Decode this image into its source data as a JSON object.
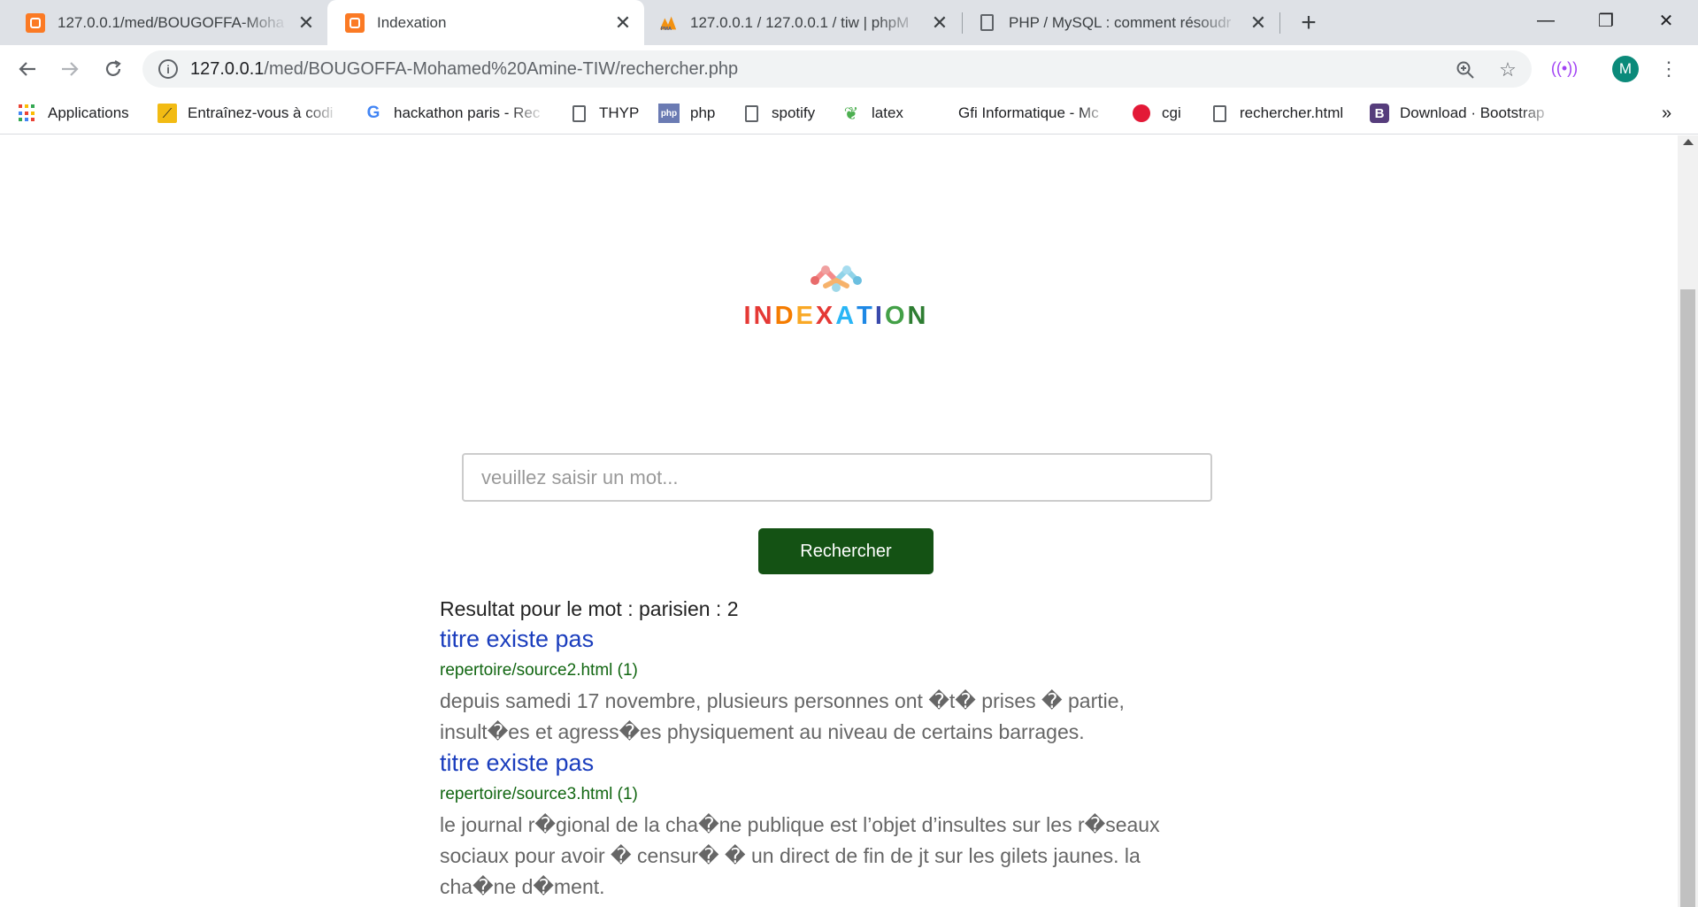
{
  "tabs": [
    {
      "title": "127.0.0.1/med/BOUGOFFA-Moha",
      "active": false
    },
    {
      "title": "Indexation",
      "active": true
    },
    {
      "title": "127.0.0.1 / 127.0.0.1 / tiw | phpM",
      "active": false
    },
    {
      "title": "PHP / MySQL : comment résoudr",
      "active": false
    }
  ],
  "window_controls": {
    "minimize": "—",
    "restore": "❐",
    "close": "✕"
  },
  "toolbar": {
    "url_host": "127.0.0.1",
    "url_path": "/med/BOUGOFFA-Mohamed%20Amine-TIW/rechercher.php",
    "avatar_letter": "M"
  },
  "bookmarks": [
    {
      "label": "Applications",
      "icon": "apps-grid-icon"
    },
    {
      "label": "Entraînez-vous à codi",
      "icon": "codingame-icon"
    },
    {
      "label": "hackathon paris - Rec",
      "icon": "google-icon"
    },
    {
      "label": "THYP",
      "icon": "page-icon"
    },
    {
      "label": "php",
      "icon": "php-icon"
    },
    {
      "label": "spotify",
      "icon": "page-icon"
    },
    {
      "label": "latex",
      "icon": "overleaf-icon"
    },
    {
      "label": "Gfi Informatique - Mc",
      "icon": "none"
    },
    {
      "label": "cgi",
      "icon": "cgi-icon"
    },
    {
      "label": "rechercher.html",
      "icon": "page-icon"
    },
    {
      "label": "Download · Bootstrap",
      "icon": "bootstrap-icon"
    }
  ],
  "bookmarks_overflow": "»",
  "logo": {
    "text": "INDEXATION",
    "letter_colors": [
      "#e53935",
      "#e53935",
      "#f57c00",
      "#f9a825",
      "#e53935",
      "#29b6f6",
      "#1e88e5",
      "#3949ab",
      "#43a047",
      "#2e7d32"
    ]
  },
  "search": {
    "placeholder": "veuillez saisir un mot...",
    "value": "",
    "button_label": "Rechercher"
  },
  "results": {
    "heading": "Resultat pour le mot : parisien : 2",
    "items": [
      {
        "title": "titre existe pas",
        "link": "repertoire/source2.html (1)",
        "snippet": "depuis samedi 17 novembre, plusieurs personnes ont �t� prises � partie, insult�es et agress�es physiquement au niveau de certains barrages."
      },
      {
        "title": "titre existe pas",
        "link": "repertoire/source3.html (1)",
        "snippet": "le journal r�gional de la cha�ne publique est l’objet d’insultes sur les r�seaux sociaux pour avoir � censur� � un direct de fin de jt sur les gilets jaunes. la cha�ne d�ment."
      }
    ]
  }
}
